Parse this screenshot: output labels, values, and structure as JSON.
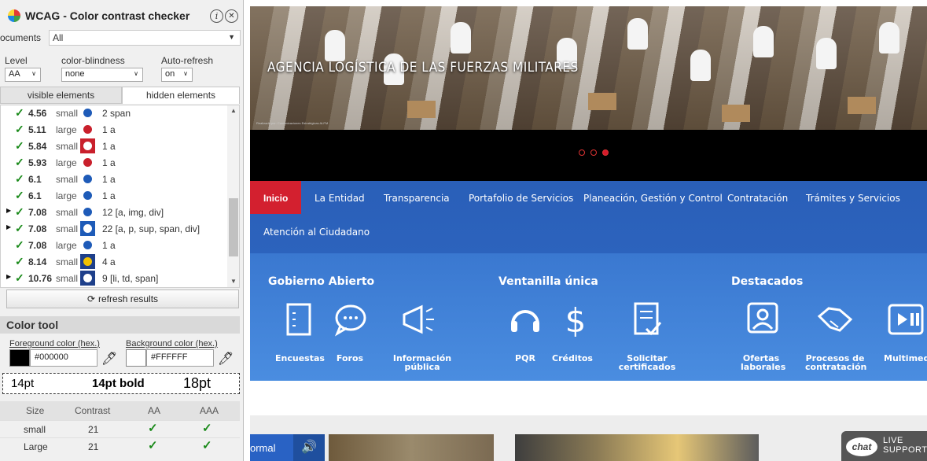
{
  "panel": {
    "title": "WCAG - Color contrast checker",
    "info_icon": "info-icon",
    "close_icon": "close-icon",
    "documents_label": "ocuments",
    "documents_value": "All",
    "level_label": "Level",
    "level_value": "AA",
    "colorblind_label": "color-blindness",
    "colorblind_value": "none",
    "autorefresh_label": "Auto-refresh",
    "autorefresh_value": "on",
    "tab_visible": "visible elements",
    "tab_hidden": "hidden elements",
    "results": [
      {
        "expand": false,
        "ratio": "4.56",
        "size": "small",
        "swatch_bg": "#ffffff",
        "dot": "#1e5bb8",
        "count": "2 span"
      },
      {
        "expand": false,
        "ratio": "5.11",
        "size": "large",
        "swatch_bg": "#ffffff",
        "dot": "#c9202c",
        "count": "1 a"
      },
      {
        "expand": false,
        "ratio": "5.84",
        "size": "small",
        "swatch_bg": "#c9202c",
        "dot": "#ffffff",
        "count": "1 a"
      },
      {
        "expand": false,
        "ratio": "5.93",
        "size": "large",
        "swatch_bg": "#ffffff",
        "dot": "#c9202c",
        "count": "1 a"
      },
      {
        "expand": false,
        "ratio": "6.1",
        "size": "small",
        "swatch_bg": "#ffffff",
        "dot": "#1e5bb8",
        "count": "1 a"
      },
      {
        "expand": false,
        "ratio": "6.1",
        "size": "large",
        "swatch_bg": "#ffffff",
        "dot": "#1e5bb8",
        "count": "1 a"
      },
      {
        "expand": true,
        "ratio": "7.08",
        "size": "small",
        "swatch_bg": "#ffffff",
        "dot": "#1e5bb8",
        "count": "12 [a, img, div]"
      },
      {
        "expand": true,
        "ratio": "7.08",
        "size": "small",
        "swatch_bg": "#1e5bb8",
        "dot": "#ffffff",
        "count": "22 [a, p, sup, span, div]"
      },
      {
        "expand": false,
        "ratio": "7.08",
        "size": "large",
        "swatch_bg": "#ffffff",
        "dot": "#1e5bb8",
        "count": "1 a"
      },
      {
        "expand": false,
        "ratio": "8.14",
        "size": "small",
        "swatch_bg": "#1e3f8a",
        "dot": "#f2c200",
        "count": "4 a"
      },
      {
        "expand": true,
        "ratio": "10.76",
        "size": "small",
        "swatch_bg": "#1e3f8a",
        "dot": "#ffffff",
        "count": "9 [li, td, span]"
      }
    ],
    "refresh_label": "refresh results",
    "color_tool_title": "Color tool",
    "fg_label": "Foreground color (hex.)",
    "fg_value": "#000000",
    "fg_color": "#000000",
    "bg_label": "Background color (hex.)",
    "bg_value": "#FFFFFF",
    "bg_color": "#ffffff",
    "sample_14": "14pt",
    "sample_14b": "14pt bold",
    "sample_18": "18pt",
    "table_headers": [
      "Size",
      "Contrast",
      "AA",
      "AAA"
    ],
    "table_rows": [
      {
        "size": "small",
        "contrast": "21",
        "aa": "✓",
        "aaa": "✓"
      },
      {
        "size": "Large",
        "contrast": "21",
        "aa": "✓",
        "aaa": "✓"
      }
    ]
  },
  "site": {
    "hero_title": "AGENCIA LOGÍSTICA DE LAS FUERZAS MILITARES",
    "hero_credit": "Realizado por: Comunicaciones Estratégicas ALFM",
    "nav": [
      "Inicio",
      "La Entidad",
      "Transparencia",
      "Portafolio de Servicios",
      "Planeación, Gestión y Control",
      "Contratación",
      "Trámites y Servicios",
      "Atención al Ciudadano"
    ],
    "sections": [
      "Gobierno Abierto",
      "Ventanilla única",
      "Destacados"
    ],
    "services": [
      "Encuestas",
      "Foros",
      "Información pública",
      "PQR",
      "Créditos",
      "Solicitar certificados",
      "Ofertas laborales",
      "Procesos de contratación",
      "Multimedi"
    ],
    "contrast_label": "ormal",
    "chat_label": "chat",
    "live_label": "LIVE",
    "support_label": "SUPPORT",
    "accent_red": "#d3202f",
    "accent_blue": "#2c63bd"
  }
}
